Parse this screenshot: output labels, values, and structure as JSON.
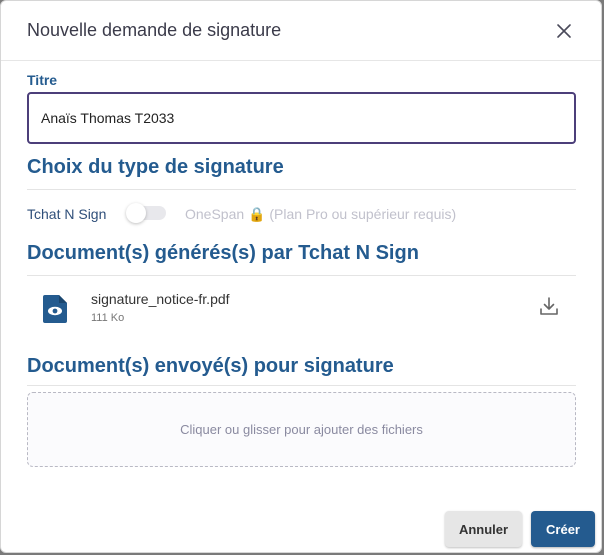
{
  "dialog": {
    "title": "Nouvelle demande de signature"
  },
  "form": {
    "titre_label": "Titre",
    "titre_value": "Anaïs Thomas T2033"
  },
  "signature_type": {
    "section_title": "Choix du type de signature",
    "left_option": "Tchat N Sign",
    "right_option": "OneSpan 🔒 (Plan Pro ou supérieur requis)",
    "toggle_on": false
  },
  "generated_docs": {
    "section_title": "Document(s) générés(s) par Tchat N Sign",
    "items": [
      {
        "name": "signature_notice-fr.pdf",
        "size": "111 Ko"
      }
    ]
  },
  "sent_docs": {
    "section_title": "Document(s) envoyé(s) pour signature",
    "dropzone_text": "Cliquer ou glisser pour ajouter des fichiers"
  },
  "actions": {
    "cancel_label": "Annuler",
    "create_label": "Créer"
  },
  "colors": {
    "accent": "#245b8f",
    "input_border": "#4c3f7a"
  }
}
